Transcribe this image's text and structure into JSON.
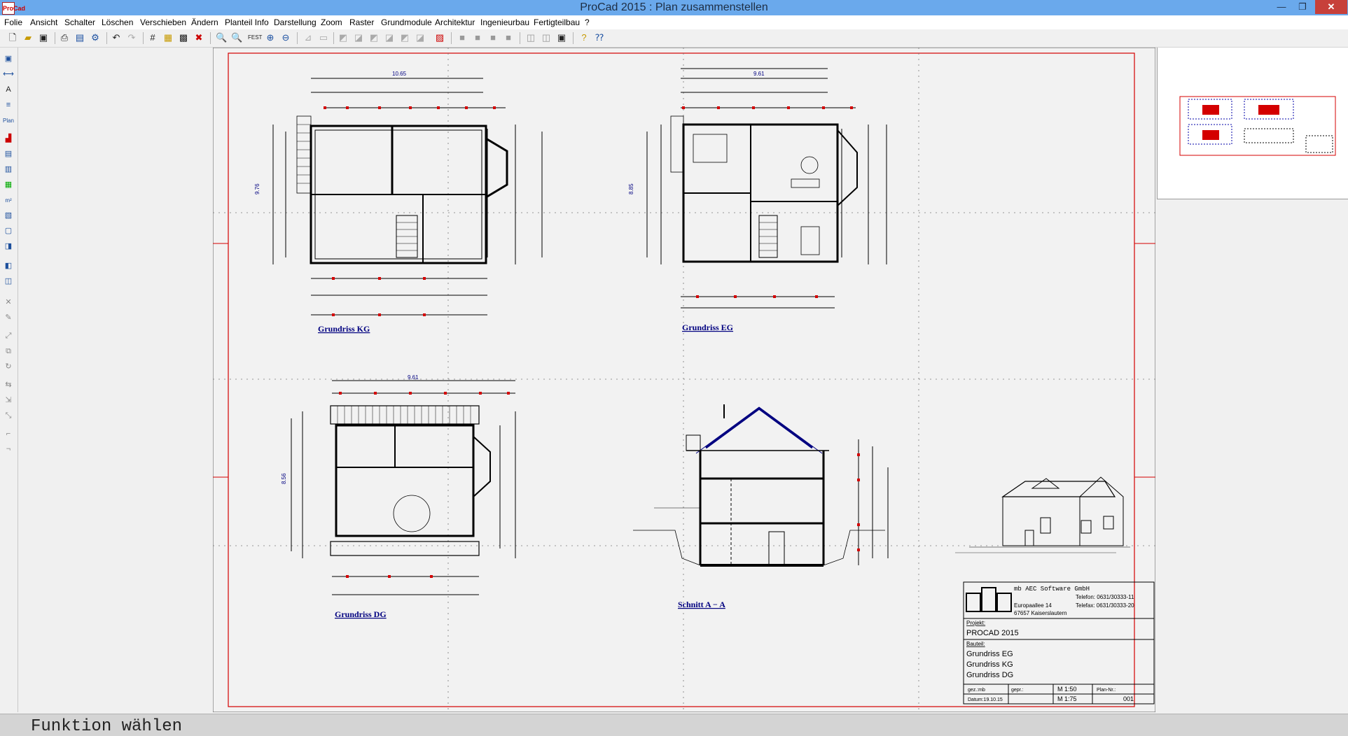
{
  "window": {
    "title": "ProCad 2015 : Plan zusammenstellen",
    "app_icon": "ProCad",
    "minimize": "—",
    "maximize": "❐",
    "close": "✕"
  },
  "menu": [
    "Folie",
    "Ansicht",
    "Schalter",
    "Löschen",
    "Verschieben",
    "Ändern",
    "Planteil Info",
    "Darstellung",
    "Zoom",
    "Raster",
    "Grundmodule",
    "Architektur",
    "Ingenieurbau",
    "Fertigteilbau",
    "?"
  ],
  "drawing": {
    "views": [
      {
        "label": "Grundriss KG",
        "width_dim": "10.65",
        "height_dim": "9.76"
      },
      {
        "label": "Grundriss EG",
        "width_dim": "9.61",
        "height_dim": "8.85"
      },
      {
        "label": "Grundriss DG",
        "width_dim": "9.61",
        "height_dim": "8.56"
      },
      {
        "label": "Schnitt  A − A"
      }
    ],
    "titleblock": {
      "company": "mb AEC Software GmbH",
      "phone": "Telefon:  0631/30333-11",
      "street": "Europaallee 14",
      "fax": "Telefax:  0631/30333-20",
      "city": "67657 Kaiserslautern",
      "projekt_label": "Projekt:",
      "projekt": "PROCAD 2015",
      "bauteil_label": "Bauteil:",
      "bauteile": [
        "Grundriss EG",
        "Grundriss KG",
        "Grundriss DG"
      ],
      "gez_label": "gez.:mb",
      "gepr_label": "gepr.:",
      "scale1": "M  1:50",
      "scale2": "M  1:75",
      "plan_label": "Plan-Nr.:",
      "plan_no": "001",
      "date": "Datum:19.10.15"
    },
    "accent": "#d40000",
    "line_color": "#000000",
    "dim_color": "#000080"
  },
  "status": {
    "message": "Funktion wählen"
  }
}
